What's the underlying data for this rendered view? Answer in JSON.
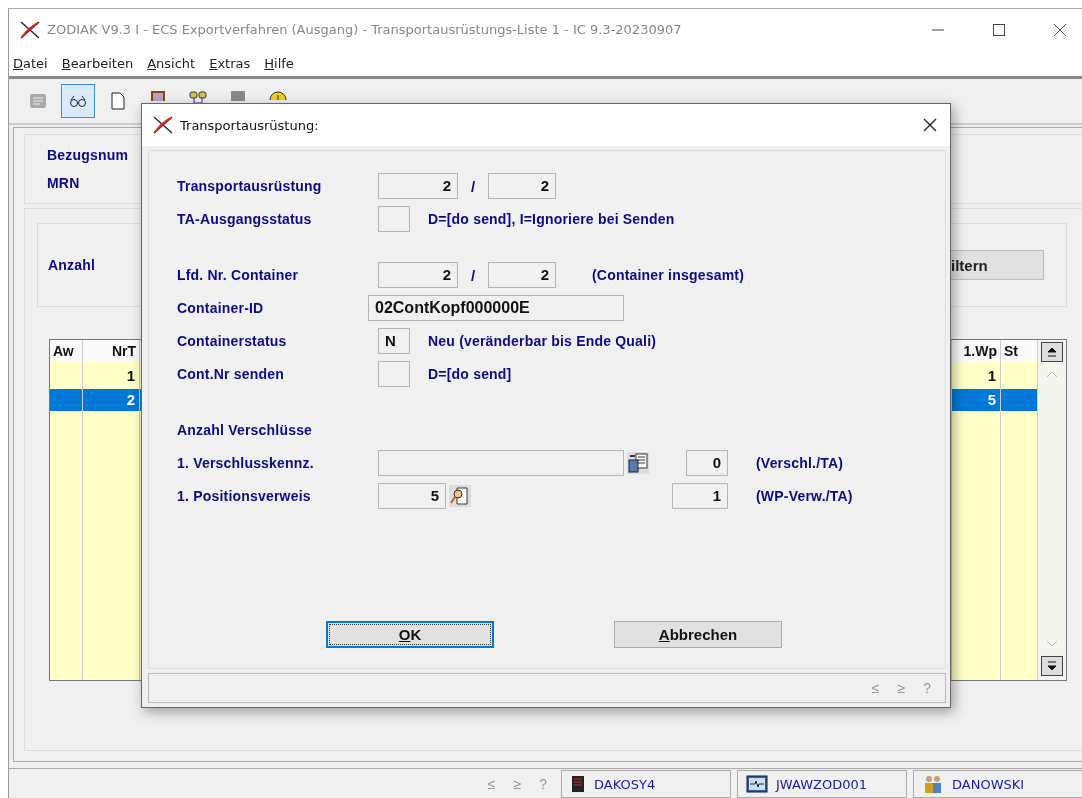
{
  "window": {
    "title": "ZODIAK V9.3 I - ECS Exportverfahren (Ausgang) - Transportausrüstungs-Liste 1 - IC 9.3-20230907"
  },
  "menu": [
    {
      "label": "Datei"
    },
    {
      "label": "Bearbeiten"
    },
    {
      "label": "Ansicht"
    },
    {
      "label": "Extras"
    },
    {
      "label": "Hilfe"
    }
  ],
  "toolbar": [
    {
      "kind": "form",
      "selected": false
    },
    {
      "kind": "glasses",
      "selected": true
    },
    {
      "kind": "page",
      "selected": false
    },
    {
      "kind": "book",
      "selected": false
    },
    {
      "kind": "links",
      "selected": false
    },
    {
      "kind": "block",
      "selected": false
    },
    {
      "kind": "clock",
      "selected": false
    }
  ],
  "header_fields": [
    {
      "label": "Bezugsnum"
    },
    {
      "label": "MRN"
    }
  ],
  "filter": {
    "label": "Anzahl",
    "button": "iltern"
  },
  "table": {
    "columns_left": [
      "Aw",
      "NrT"
    ],
    "columns_right": [
      "1.Wp",
      "St"
    ],
    "rows": [
      {
        "nr": "1",
        "wp": "1",
        "selected": false
      },
      {
        "nr": "2",
        "wp": "5",
        "selected": true
      }
    ]
  },
  "status_bar": {
    "nav": [
      "≤",
      "≥",
      "?"
    ],
    "panels": [
      {
        "kind": "server",
        "label": "DAKOSY4"
      },
      {
        "kind": "terminal",
        "label": "JWAWZOD001"
      },
      {
        "kind": "users",
        "label": "DANOWSKI"
      }
    ]
  },
  "dialog": {
    "title": "Transportausrüstung:",
    "groups": [
      [
        {
          "kind": "count",
          "label": "Transportausrüstung",
          "value": "2",
          "separator": "/",
          "total": "2"
        },
        {
          "kind": "code",
          "label": "TA-Ausgangsstatus",
          "note": "D=[do send], I=Ignoriere bei Senden"
        }
      ],
      [
        {
          "kind": "count",
          "label": "Lfd. Nr. Container",
          "value": "2",
          "separator": "/",
          "total": "2",
          "note": "(Container insgesamt)"
        },
        {
          "kind": "text",
          "label": "Container-ID",
          "value": "02ContKopf000000E"
        },
        {
          "kind": "code",
          "label": "Containerstatus",
          "value": "N",
          "note": "Neu (veränderbar bis Ende Quali)"
        },
        {
          "kind": "code",
          "label": "Cont.Nr senden",
          "note": "D=[do send]"
        }
      ],
      [
        {
          "kind": "heading",
          "label": "Anzahl Verschlüsse"
        },
        {
          "kind": "seal",
          "label": "1. Verschlusskennz.",
          "count": "0",
          "note": "(Verschl./TA)"
        },
        {
          "kind": "position",
          "label": "1. Positionsverweis",
          "value": "5",
          "count": "1",
          "note": "(WP-Verw./TA)"
        }
      ]
    ],
    "buttons": [
      {
        "label": "OK",
        "focused": true
      },
      {
        "label": "Abbrechen",
        "focused": false
      }
    ],
    "nav": [
      "≤",
      "≥",
      "?"
    ]
  }
}
